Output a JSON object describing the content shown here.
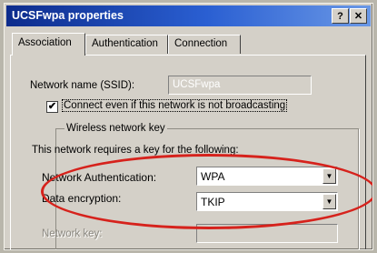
{
  "window": {
    "title": "UCSFwpa properties",
    "help_button": "?",
    "close_button": "✕"
  },
  "tabs": [
    {
      "label": "Association"
    },
    {
      "label": "Authentication"
    },
    {
      "label": "Connection"
    }
  ],
  "association": {
    "ssid_label": "Network name (SSID):",
    "ssid_value": "UCSFwpa",
    "broadcast_checkbox_label": "Connect even if this network is not broadcasting",
    "broadcast_checked": true,
    "wireless_key_group": "Wireless network key",
    "requires_text": "This network requires a key for the following:",
    "auth_label": "Network Authentication:",
    "auth_value": "WPA",
    "encryption_label": "Data encryption:",
    "encryption_value": "TKIP",
    "network_key_label": "Network key:"
  },
  "colors": {
    "titlebar_start": "#0d2c8c",
    "titlebar_end": "#6a98e6",
    "annotation": "#d6221c"
  }
}
